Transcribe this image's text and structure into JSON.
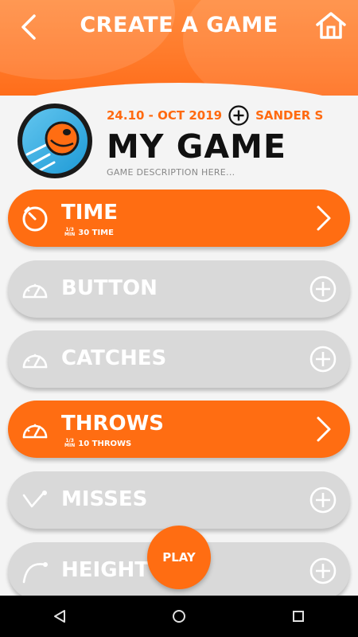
{
  "header": {
    "title": "CREATE A GAME",
    "back_icon": "chevron-left-icon",
    "home_icon": "home-icon"
  },
  "game": {
    "date": "24.10 - OCT 2019",
    "author": "SANDER S",
    "name": "MY GAME",
    "description": "GAME DESCRIPTION HERE..."
  },
  "rows": [
    {
      "label": "TIME",
      "icon": "timer-icon",
      "active": true,
      "sub": "30 TIME",
      "mini_top": "1/3",
      "mini_bottom": "MIN"
    },
    {
      "label": "BUTTON",
      "icon": "gauge-icon",
      "active": false
    },
    {
      "label": "CATCHES",
      "icon": "gauge-icon",
      "active": false
    },
    {
      "label": "THROWS",
      "icon": "gauge-icon",
      "active": true,
      "sub": "10 THROWS",
      "mini_top": "1/3",
      "mini_bottom": "MIN"
    },
    {
      "label": "MISSES",
      "icon": "trajectory-icon",
      "active": false
    },
    {
      "label": "HEIGHT",
      "icon": "arc-icon",
      "active": false
    }
  ],
  "play_label": "PLAY",
  "colors": {
    "accent": "#ff6d12",
    "inactive": "#d9d9d9"
  },
  "navbar": {
    "back": "nav-back-icon",
    "home": "nav-home-icon",
    "recents": "nav-recents-icon"
  }
}
